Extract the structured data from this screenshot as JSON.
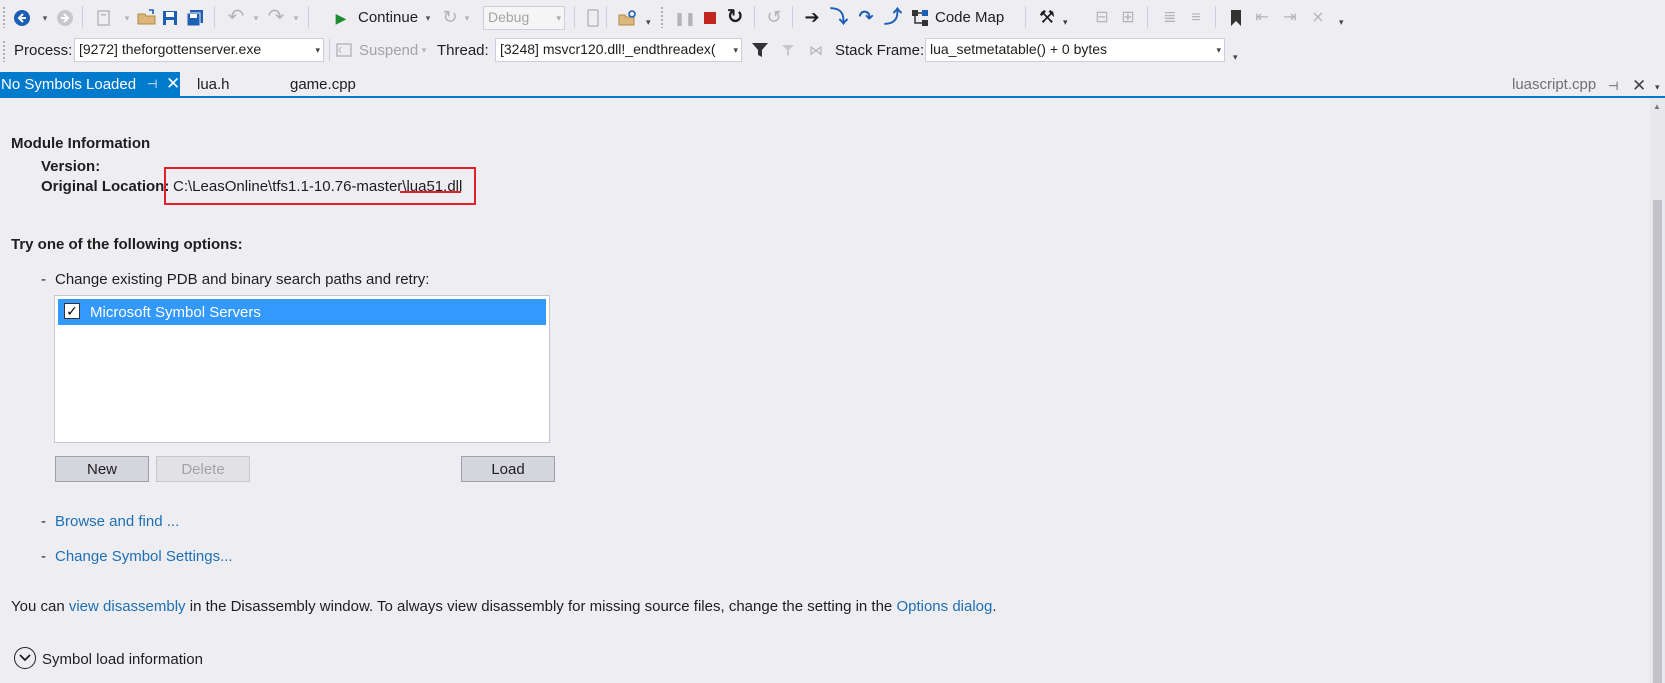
{
  "toolbar": {
    "continue_label": "Continue",
    "config_value": "Debug",
    "code_map_label": "Code Map",
    "process_label": "Process:",
    "process_value": "[9272] theforgottenserver.exe",
    "suspend_label": "Suspend",
    "thread_label": "Thread:",
    "thread_value": "[3248] msvcr120.dll!_endthreadex(",
    "stack_frame_label": "Stack Frame:",
    "stack_frame_value": "lua_setmetatable() + 0 bytes"
  },
  "tabs": {
    "active": "No Symbols Loaded",
    "items": [
      "lua.h",
      "game.cpp"
    ],
    "right": "luascript.cpp"
  },
  "module_info": {
    "heading": "Module Information",
    "version_label": "Version:",
    "location_label": "Original Location:",
    "location_value": "C:\\LeasOnline\\tfs1.1-10.76-master\\lua51.dll"
  },
  "options": {
    "heading": "Try one of the following options:",
    "change_paths": "Change existing PDB and binary search paths and retry:",
    "list_items": [
      {
        "label": "Microsoft Symbol Servers",
        "checked": true
      }
    ],
    "new_label": "New",
    "delete_label": "Delete",
    "load_label": "Load",
    "browse_link": "Browse and find ...",
    "settings_link": "Change Symbol Settings..."
  },
  "footer": {
    "text_1": "You can ",
    "link_1": "view disassembly",
    "text_2": " in the Disassembly window. To always view disassembly for missing source files, change the setting in the ",
    "link_2": "Options dialog",
    "text_3": ".",
    "symbol_load_info": "Symbol load information"
  },
  "colors": {
    "accent": "#007acc",
    "selection": "#3399ff",
    "link": "#1e6fb4",
    "highlight_box": "#e0202a",
    "stop": "#c0251f",
    "continue_green": "#1e8c33"
  }
}
